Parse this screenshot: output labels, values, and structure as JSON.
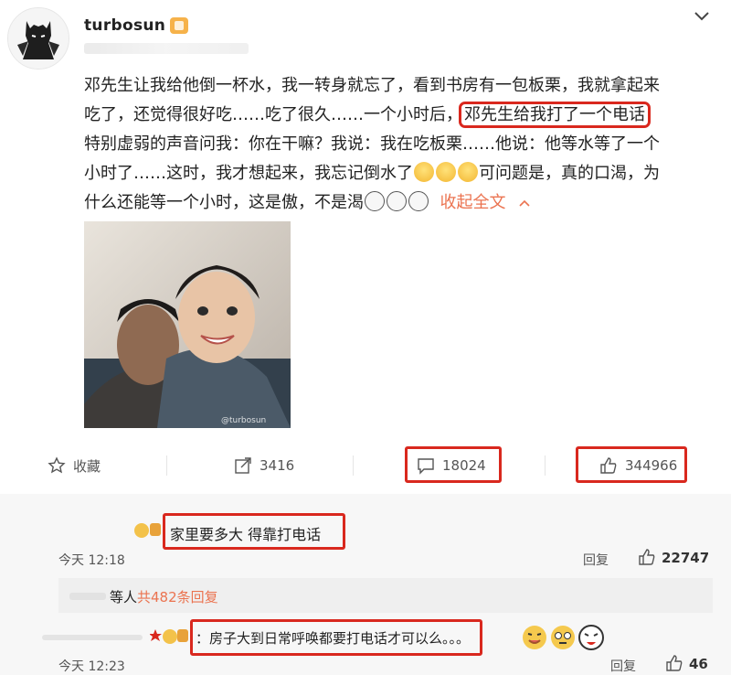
{
  "header": {
    "username": "turbosun"
  },
  "post": {
    "line1": "邓先生让我给他倒一杯水，我一转身就忘了，看到书房有一包板栗，我就拿起来",
    "line2_a": "吃了，还觉得很好吃……吃了很久……一个小时后，",
    "line2_highlight": "邓先生给我打了一个电话",
    "line3": "特别虚弱的声音问我：你在干嘛？我说：我在吃板栗……他说：他等水等了一个",
    "line4_a": "小时了……这时，我才想起来，我忘记倒水了",
    "line4_b": "可问题是，真的口渴，为",
    "line5_a": "什么还能等一个小时，这是傲，不是渴",
    "collapse": "收起全文",
    "photo_watermark": "@turbosun"
  },
  "actions": {
    "favorite_label": "收藏",
    "repost_count": "3416",
    "comment_count": "18024",
    "like_count": "344966"
  },
  "comments": [
    {
      "text": "家里要多大 得靠打电话",
      "time": "今天 12:18",
      "reply_label": "回复",
      "likes": "22747"
    },
    {
      "text": "：房子大到日常呼唤都要打电话才可以么。。。",
      "time": "今天 12:23",
      "reply_label": "回复",
      "likes": "46"
    }
  ],
  "sub_replies": {
    "prefix": "等人",
    "link": "共482条回复"
  },
  "colors": {
    "highlight_box": "#d9281e",
    "link": "#eb7350"
  }
}
